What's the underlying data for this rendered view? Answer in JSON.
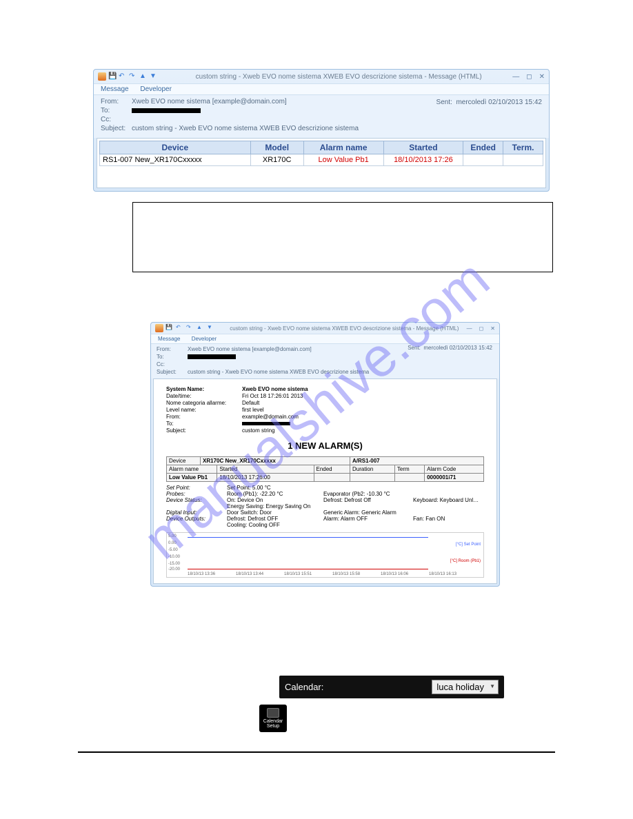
{
  "watermark": "manualshive.com",
  "win1": {
    "title": "custom string - Xweb EVO nome sistema XWEB EVO descrizione sistema - Message (HTML)",
    "menu": {
      "message": "Message",
      "developer": "Developer"
    },
    "headers": {
      "from_lbl": "From:",
      "from_val": "Xweb EVO nome sistema [example@domain.com]",
      "to_lbl": "To:",
      "cc_lbl": "Cc:",
      "subject_lbl": "Subject:",
      "subject_val": "custom string - Xweb EVO nome sistema XWEB EVO descrizione sistema",
      "sent_lbl": "Sent:",
      "sent_val": "mercoledì 02/10/2013 15:42"
    },
    "table": {
      "headers": {
        "device": "Device",
        "model": "Model",
        "alarm": "Alarm name",
        "started": "Started",
        "ended": "Ended",
        "term": "Term."
      },
      "row": {
        "device": "RS1-007 New_XR170Cxxxxx",
        "model": "XR170C",
        "alarm": "Low Value Pb1",
        "started": "18/10/2013 17:26",
        "ended": "",
        "term": ""
      }
    }
  },
  "win2": {
    "title": "custom string - Xweb EVO nome sistema XWEB EVO descrizione sistema - Message (HTML)",
    "menu": {
      "message": "Message",
      "developer": "Developer"
    },
    "headers": {
      "from_lbl": "From:",
      "from_val": "Xweb EVO nome sistema [example@domain.com]",
      "to_lbl": "To:",
      "cc_lbl": "Cc:",
      "subject_lbl": "Subject:",
      "subject_val": "custom string - Xweb EVO nome sistema XWEB EVO descrizione sistema",
      "sent_lbl": "Sent:",
      "sent_val": "mercoledì 02/10/2013 15:42"
    },
    "sys": {
      "name_l": "System Name:",
      "name_v": "Xweb EVO nome sistema",
      "dt_l": "Date/time:",
      "dt_v": "Fri Oct 18 17:26:01 2013",
      "cat_l": "Nome categoria allarme:",
      "cat_v": "Default",
      "lvl_l": "Level name:",
      "lvl_v": "first level",
      "from_l": "From:",
      "from_v": "example@domain.com",
      "to_l": "To:",
      "to_v": "",
      "subj_l": "Subject:",
      "subj_v": "custom string"
    },
    "heading": "1 NEW ALARM(S)",
    "detail": {
      "device_l": "Device",
      "device_v": "XR170C New_XR170Cxxxxx",
      "a_l": "A/RS1-007",
      "an_l": "Alarm name",
      "started_l": "Started",
      "ended_l": "Ended",
      "dur_l": "Duration",
      "term_l": "Term",
      "code_l": "Alarm Code",
      "an_v": "Low Value Pb1",
      "started_v": "18/10/2013 17:26:00",
      "ended_v": "",
      "dur_v": "",
      "term_v": "",
      "code_v": "0000001i71"
    },
    "kv": {
      "sp_l": "Set Point:",
      "sp_v": "Set Point: 5.00 °C",
      "pr_l": "Probes:",
      "pr_v": "Room (Pb1): -22.20 °C",
      "pr_v2": "Evaporator (Pb2: -10.30 °C",
      "ds_l": "Device Status:",
      "ds_v": "On: Device On",
      "ds_v1b": "Energy Saving: Energy Saving On",
      "ds_v2": "Defrost: Defrost Off",
      "ds_v3": "Keyboard: Keyboard Unl…",
      "di_l": "Digital Input:",
      "di_v": "Door Switch: Door",
      "di_v2": "Generic Alarm: Generic Alarm",
      "do_l": "Device Outputs:",
      "do_v": "Defrost: Defrost OFF",
      "do_v1b": "Cooling: Cooling OFF",
      "do_v2": "Alarm: Alarm OFF",
      "do_v3": "Fan: Fan ON"
    },
    "chart": {
      "legend1": "[°C] Set Point",
      "legend2": "[°C] Room (Pb1)",
      "yticks": [
        "5.00",
        "0.00",
        "-5.00",
        "-10.00",
        "-15.00",
        "-20.00"
      ],
      "xticks": [
        "18/10/13 13:36",
        "18/10/13 13:44",
        "18/10/13 15:51",
        "18/10/13 15:58",
        "18/10/13 16:06",
        "18/10/13 16:13"
      ]
    }
  },
  "chart_data": {
    "type": "line",
    "title": "",
    "xlabel": "",
    "ylabel": "°C",
    "ylim": [
      -22,
      6
    ],
    "x": [
      "18/10/13 13:36",
      "18/10/13 13:44",
      "18/10/13 15:51",
      "18/10/13 15:58",
      "18/10/13 16:06",
      "18/10/13 16:13"
    ],
    "series": [
      {
        "name": "Set Point",
        "color": "#3a5fff",
        "values": [
          5.0,
          5.0,
          5.0,
          5.0,
          5.0,
          5.0
        ]
      },
      {
        "name": "Room (Pb1)",
        "color": "#d00000",
        "values": [
          -22.2,
          -22.2,
          -22.2,
          -22.2,
          -22.2,
          -22.2
        ]
      }
    ]
  },
  "calendar": {
    "label": "Calendar:",
    "value": "luca holiday",
    "icon_label": "Calendar Setup"
  }
}
